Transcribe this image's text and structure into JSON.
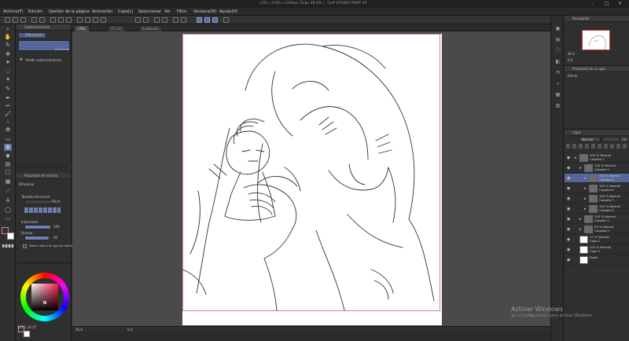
{
  "titlebar": {
    "title": "s761 | 2760 x 1000px 72dpi 46.6% | - CLIP STUDIO PAINT EX"
  },
  "menu": [
    "Archivo(F)",
    "Edición",
    "Gestión de la página",
    "Animación",
    "Capa(L)",
    "Seleccionar",
    "Ver",
    "Filtro",
    "Ventana(W)",
    "Ayuda(H)"
  ],
  "tabs": [
    "s761",
    "17 (s1)",
    "Ilustración"
  ],
  "subtool": {
    "header": "Subherramienta",
    "tab_label": "Difuminar",
    "preset_label": "Difuminar",
    "add_label": "Añadir subherramienta"
  },
  "toolprop": {
    "header": "Propiedad de herram.",
    "tool_name": "Difuminar",
    "brush_size_label": "Tamaño del pincel",
    "brush_size_value": "760.0",
    "intensity_label": "Intensidad",
    "intensity_value": "100",
    "intensity_fraction": 1.0,
    "hardness_label": "Dureza",
    "hardness_value": "90",
    "hardness_fraction": 0.9,
    "refer_label": "Referir solo a la capa de edición"
  },
  "status": {
    "zoom": "46.6",
    "angle": "0.0",
    "coords": "347.1  24  27"
  },
  "navigator": {
    "header": "Navegador",
    "zoom": "46.6",
    "angle": "0.0"
  },
  "layerprop": {
    "header": "Propiedad de la capa",
    "effect_label": "Efecto"
  },
  "layers": {
    "header": "Capa",
    "blend_mode": "Normal",
    "opacity": "100",
    "rows": [
      {
        "line1": "100 % Normal",
        "line2": "Carpeta 1",
        "indent": 0,
        "folder": true,
        "sel": false
      },
      {
        "line1": "100 % Normal",
        "line2": "Carpeta 3",
        "indent": 1,
        "folder": true,
        "sel": false
      },
      {
        "line1": "100 % Normal",
        "line2": "Carpeta 8",
        "indent": 2,
        "folder": true,
        "sel": true
      },
      {
        "line1": "100 % Normal",
        "line2": "Carpeta 6",
        "indent": 2,
        "folder": true,
        "sel": false
      },
      {
        "line1": "100 % Normal",
        "line2": "Carpeta 7",
        "indent": 2,
        "folder": true,
        "sel": false
      },
      {
        "line1": "100 % Normal",
        "line2": "Carpeta 4",
        "indent": 2,
        "folder": true,
        "sel": false
      },
      {
        "line1": "100 % Normal",
        "line2": "Carpeta 2",
        "indent": 1,
        "folder": true,
        "sel": false
      },
      {
        "line1": "29 % Normal",
        "line2": "Carpeta 5",
        "indent": 1,
        "folder": true,
        "sel": false
      },
      {
        "line1": "27 % Normal",
        "line2": "Capa 2",
        "indent": 0,
        "folder": false,
        "sel": false
      },
      {
        "line1": "100 % Normal",
        "line2": "Capa 1",
        "indent": 0,
        "folder": false,
        "sel": false
      },
      {
        "line1": "",
        "line2": "Papel",
        "indent": 0,
        "folder": false,
        "sel": false
      }
    ]
  },
  "watermark": {
    "title": "Activar Windows",
    "subtitle": "Ve a Configuración para activar Windows."
  },
  "colors": {
    "accent": "#5e6ea3",
    "selection": "#56659a",
    "canvas_bg": "#4a4a4a",
    "main_color": "#4a2530",
    "sub_color": "#ffffff"
  }
}
